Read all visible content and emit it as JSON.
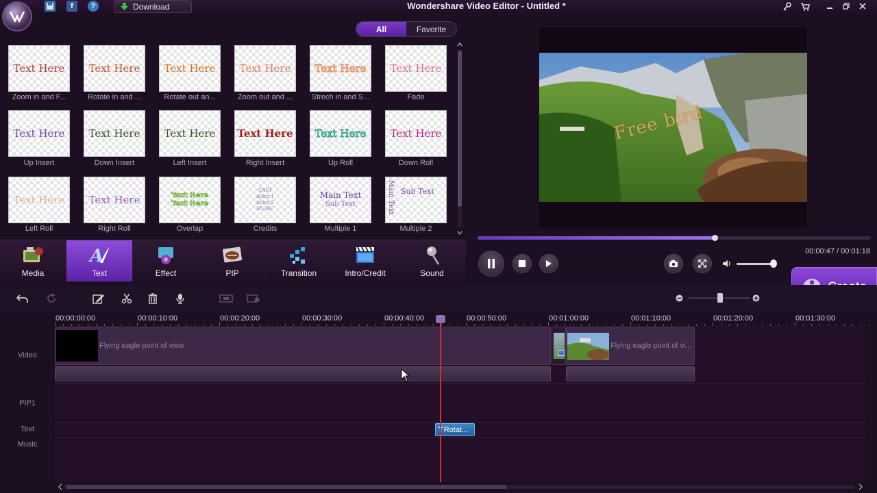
{
  "titlebar": {
    "download_label": "Download",
    "app_title": "Wondershare Video Editor - Untitled *"
  },
  "library": {
    "filter_tabs": [
      {
        "label": "All",
        "active": true
      },
      {
        "label": "Favorite",
        "active": false
      }
    ],
    "presets": [
      {
        "sample": "Text Here",
        "label": "Zoom in and F...",
        "color": "#b03a3a"
      },
      {
        "sample": "Text Here",
        "label": "Rotate in and ...",
        "color": "#c0502a"
      },
      {
        "sample": "Text Here",
        "label": "Rotate out an...",
        "color": "#d87020"
      },
      {
        "sample": "Text Here",
        "label": "Zoom out and ...",
        "color": "#e08060"
      },
      {
        "sample": "Text Here",
        "label": "Strech in and S...",
        "color": "#e09060"
      },
      {
        "sample": "Text Here",
        "label": "Fade",
        "color": "#e07090"
      },
      {
        "sample": "Text Here",
        "label": "Up Insert",
        "color": "#7040b0"
      },
      {
        "sample": "Text Here",
        "label": "Down Insert",
        "color": "#305020"
      },
      {
        "sample": "Text Here",
        "label": "Left Insert",
        "color": "#305828"
      },
      {
        "sample": "Text Here",
        "label": "Right Insert",
        "color": "#a02020"
      },
      {
        "sample": "Text Here",
        "label": "Up Roll",
        "color": "#30a080"
      },
      {
        "sample": "Text Here",
        "label": "Down Roll",
        "color": "#c02080"
      },
      {
        "sample": "Text Here",
        "label": "Left Roll",
        "color": "#e0a070"
      },
      {
        "sample": "Text Here",
        "label": "Right Roll",
        "color": "#9060c0"
      },
      {
        "sample": "",
        "label": "Overlap",
        "color": "#40a040"
      },
      {
        "sample": "",
        "label": "Credits",
        "color": "#8080a0"
      },
      {
        "sample": "",
        "label": "Multiple 1",
        "color": "#7040a0"
      },
      {
        "sample": "",
        "label": "Multiple 2",
        "color": "#8040a0"
      }
    ],
    "overlap_text": "Text Here",
    "credits_lines": [
      "CAST",
      "Actor 1",
      "Actor 2",
      "MUSIC"
    ],
    "multiple1_main": "Main Text",
    "multiple1_sub": "Sub Text",
    "multiple2_vertical": "Main Text",
    "multiple2_sub": "Sub Text"
  },
  "categories": [
    {
      "label": "Media",
      "icon": "media-icon",
      "active": false
    },
    {
      "label": "Text",
      "icon": "text-icon",
      "active": true
    },
    {
      "label": "Effect",
      "icon": "effect-icon",
      "active": false
    },
    {
      "label": "PIP",
      "icon": "pip-icon",
      "active": false
    },
    {
      "label": "Transition",
      "icon": "transition-icon",
      "active": false
    },
    {
      "label": "Intro/Credit",
      "icon": "intro-credit-icon",
      "active": false
    },
    {
      "label": "Sound",
      "icon": "sound-icon",
      "active": false
    }
  ],
  "preview": {
    "overlay_text": "Free bird",
    "timecode": "00:00:47 / 00:01:18",
    "progress_fraction": 0.603,
    "volume_fraction": 0.85
  },
  "create_label": "Create",
  "timeline": {
    "ruler": [
      "00:00:00:00",
      "00:00:10:00",
      "00:00:20:00",
      "00:00:30:00",
      "00:00:40:00",
      "00:00:50:00",
      "00:01:00:00",
      "00:01:10:00",
      "00:01:20:00",
      "00:01:30:00"
    ],
    "tracks": [
      "Video",
      "PIP1",
      "Text",
      "Music"
    ],
    "video_clips": [
      {
        "title": "Flying eagle point of view"
      },
      {
        "title": "Flying eagle point of vi..."
      }
    ],
    "text_clip": "Rotat...",
    "text_clip_icon": "T"
  },
  "colors": {
    "accent": "#7b3ac4",
    "background": "#1c0f22",
    "playhead": "#e02a2a",
    "text_clip": "#2e74b6"
  }
}
